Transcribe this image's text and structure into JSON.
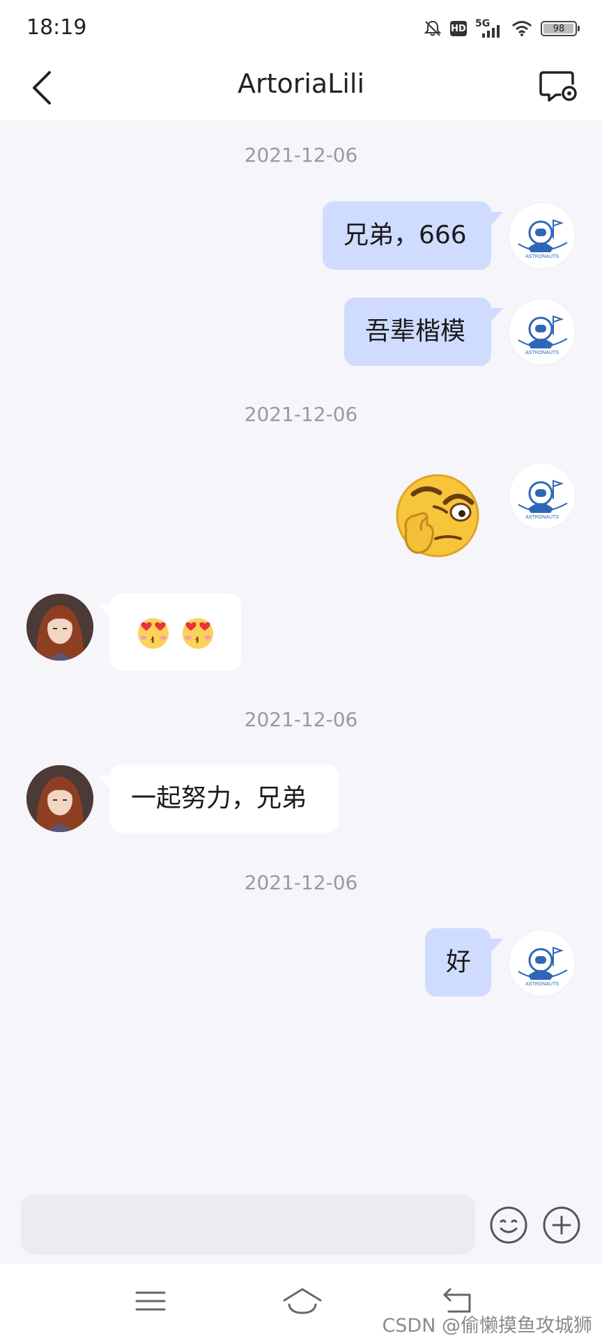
{
  "status_bar": {
    "time": "18:19",
    "network": "5G",
    "hd": "HD",
    "battery": "98"
  },
  "header": {
    "title": "ArtoriaLili"
  },
  "messages": {
    "ts1": "2021-12-06",
    "m1": "兄弟，666",
    "m2": "吾辈楷模",
    "ts2": "2021-12-06",
    "ts3": "2021-12-06",
    "m5": "一起努力，兄弟",
    "ts4": "2021-12-06",
    "m6": "好"
  },
  "avatars": {
    "me_logo_text": "ASTRONAUTS"
  },
  "input": {
    "placeholder": ""
  },
  "watermark": "CSDN @偷懒摸鱼攻城狮",
  "colors": {
    "my_bubble": "#cfdcff",
    "other_bubble": "#ffffff",
    "background": "#f5f5fa"
  }
}
